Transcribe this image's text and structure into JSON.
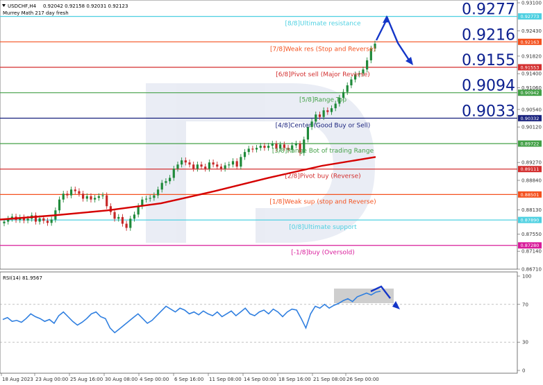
{
  "header": {
    "symbol": "USDCHF,H4",
    "ohlc": "0.92042 0.92158 0.92031 0.92123",
    "indicator": "Murrey Math 217 day fresh"
  },
  "rsi": {
    "label": "RSI(14) 81.9567",
    "ticks": [
      "100",
      "70",
      "30",
      "0"
    ],
    "levels": [
      70,
      30
    ]
  },
  "colors": {
    "bull": "#1f8a3a",
    "bear": "#c62828",
    "ma": "#d50000",
    "rsi": "#2f7fe0",
    "arrow": "#1436c8",
    "big_text": "#0b1f8f"
  },
  "icons": [
    "arrow-up-icon",
    "arrow-down-icon",
    "dropdown-triangle-icon"
  ],
  "chart_data": {
    "type": "line",
    "title": "USDCHF,H4",
    "ylim": [
      0.867,
      0.931
    ],
    "y_ticks": [
      "0.93100",
      "0.92770",
      "0.92430",
      "0.92163",
      "0.91820",
      "0.91553",
      "0.91400",
      "0.91060",
      "0.90942",
      "0.90540",
      "0.90332",
      "0.90120",
      "0.89722",
      "0.89270",
      "0.89111",
      "0.88840",
      "0.88501",
      "0.88130",
      "0.87890",
      "0.87550",
      "0.87280",
      "0.87140",
      "0.86710"
    ],
    "x_ticks": [
      "18 Aug 2023",
      "23 Aug 00:00",
      "25 Aug 16:00",
      "30 Aug 08:00",
      "4 Sep 00:00",
      "6 Sep 16:00",
      "11 Sep 08:00",
      "14 Sep 00:00",
      "18 Sep 16:00",
      "21 Sep 08:00",
      "26 Sep 00:00"
    ],
    "murrey_levels": [
      {
        "value": 0.92773,
        "tag": "0.92773",
        "label": "[8/8]Ultimate resistance",
        "color": "#4dd0e1"
      },
      {
        "value": 0.92163,
        "tag": "0.92163",
        "label": "[7/8]Weak res (Stop and Reverse)",
        "color": "#f4511e"
      },
      {
        "value": 0.91553,
        "tag": "0.91553",
        "label": "[6/8]Pivot sell (Major Reverse)",
        "color": "#d32f2f"
      },
      {
        "value": 0.90942,
        "tag": "0.90942",
        "label": "[5/8]Range Top",
        "color": "#43a047"
      },
      {
        "value": 0.90332,
        "tag": "0.90332",
        "label": "[4/8]Center (Good Buy or Sell)",
        "color": "#1a237e"
      },
      {
        "value": 0.89722,
        "tag": "0.89722",
        "label": "[3/8]Range Bot of trading Range",
        "color": "#43a047"
      },
      {
        "value": 0.89111,
        "tag": "0.89111",
        "label": "[2/8]Pivot buy (Reverse)",
        "color": "#d32f2f"
      },
      {
        "value": 0.88501,
        "tag": "0.88501",
        "label": "[1/8]Weak sup (stop and Reverse)",
        "color": "#f4511e"
      },
      {
        "value": 0.8789,
        "tag": "0.87890",
        "label": "[0/8]Ultimate support",
        "color": "#4dd0e1"
      },
      {
        "value": 0.8728,
        "tag": "0.87280",
        "label": "[-1/8]buy (Oversold)",
        "color": "#d81b9a"
      }
    ],
    "big_labels": [
      "0.9277",
      "0.9216",
      "0.9155",
      "0.9094",
      "0.9033"
    ],
    "series": [
      {
        "kind": "candles",
        "close": [
          0.8785,
          0.8792,
          0.8797,
          0.8789,
          0.8795,
          0.8788,
          0.8792,
          0.88,
          0.8785,
          0.8793,
          0.8787,
          0.8782,
          0.879,
          0.8812,
          0.8838,
          0.8852,
          0.8848,
          0.8862,
          0.8858,
          0.8852,
          0.884,
          0.8846,
          0.8838,
          0.8842,
          0.8846,
          0.8848,
          0.8822,
          0.8808,
          0.8792,
          0.8796,
          0.878,
          0.877,
          0.8792,
          0.8802,
          0.8822,
          0.8838,
          0.884,
          0.8842,
          0.8848,
          0.8862,
          0.8878,
          0.8882,
          0.889,
          0.8912,
          0.8922,
          0.8932,
          0.8927,
          0.8922,
          0.8912,
          0.8922,
          0.8917,
          0.8912,
          0.8927,
          0.8922,
          0.8917,
          0.8912,
          0.892,
          0.8922,
          0.893,
          0.8917,
          0.894,
          0.8952,
          0.896,
          0.8958,
          0.8962,
          0.8967,
          0.8962,
          0.8967,
          0.8972,
          0.896,
          0.897,
          0.8962,
          0.8957,
          0.8968,
          0.8972,
          0.895,
          0.8982,
          0.9012,
          0.9025,
          0.9042,
          0.9036,
          0.9052,
          0.9048,
          0.9057,
          0.9068,
          0.9082,
          0.9096,
          0.9112,
          0.9126,
          0.9138,
          0.914,
          0.915,
          0.9172,
          0.92,
          0.9212
        ]
      },
      {
        "kind": "ma",
        "values": [
          0.879,
          0.88,
          0.8812,
          0.8829,
          0.8858,
          0.889,
          0.8919,
          0.894
        ]
      }
    ],
    "rsi_values": [
      54,
      56,
      52,
      53,
      51,
      55,
      60,
      57,
      55,
      52,
      54,
      50,
      58,
      62,
      57,
      52,
      48,
      51,
      55,
      60,
      62,
      57,
      55,
      45,
      40,
      44,
      48,
      52,
      56,
      60,
      55,
      50,
      53,
      58,
      63,
      68,
      65,
      62,
      66,
      64,
      60,
      62,
      59,
      63,
      60,
      58,
      62,
      57,
      60,
      63,
      58,
      62,
      66,
      60,
      58,
      62,
      64,
      60,
      65,
      62,
      57,
      62,
      65,
      64,
      55,
      45,
      60,
      68,
      66,
      70,
      66,
      69,
      71,
      74,
      76,
      73,
      78,
      80,
      82,
      80,
      83,
      84
    ]
  }
}
